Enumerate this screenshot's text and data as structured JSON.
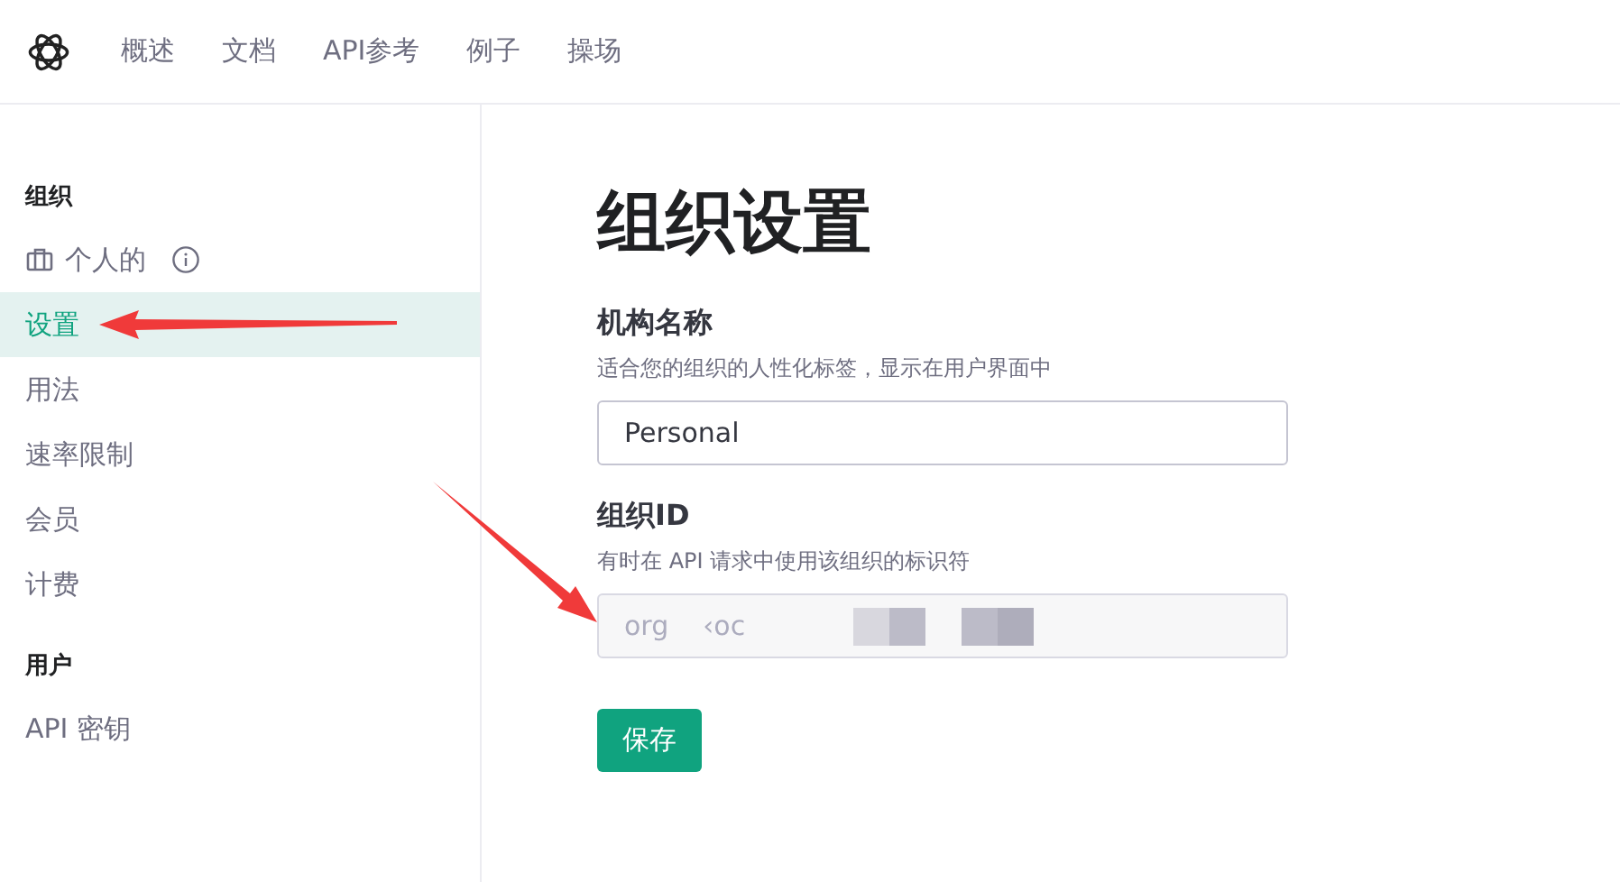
{
  "nav": {
    "items": [
      {
        "label": "概述"
      },
      {
        "label": "文档"
      },
      {
        "label": "API参考"
      },
      {
        "label": "例子"
      },
      {
        "label": "操场"
      }
    ]
  },
  "sidebar": {
    "sections": [
      {
        "heading": "组织",
        "items": [
          {
            "label": "个人的",
            "kind": "org",
            "selected": false
          },
          {
            "label": "设置",
            "kind": "link",
            "selected": true
          },
          {
            "label": "用法",
            "kind": "link",
            "selected": false
          },
          {
            "label": "速率限制",
            "kind": "link",
            "selected": false
          },
          {
            "label": "会员",
            "kind": "link",
            "selected": false
          },
          {
            "label": "计费",
            "kind": "link",
            "selected": false
          }
        ]
      },
      {
        "heading": "用户",
        "items": [
          {
            "label": "API 密钥",
            "kind": "link",
            "selected": false
          }
        ]
      }
    ]
  },
  "page": {
    "title": "组织设置",
    "fields": [
      {
        "label": "机构名称",
        "hint": "适合您的组织的人性化标签，显示在用户界面中",
        "value": "Personal",
        "disabled": false
      },
      {
        "label": "组织ID",
        "hint": "有时在 API 请求中使用该组织的标识符",
        "value": "org    ‹oc",
        "disabled": true
      }
    ],
    "save_button": "保存"
  }
}
